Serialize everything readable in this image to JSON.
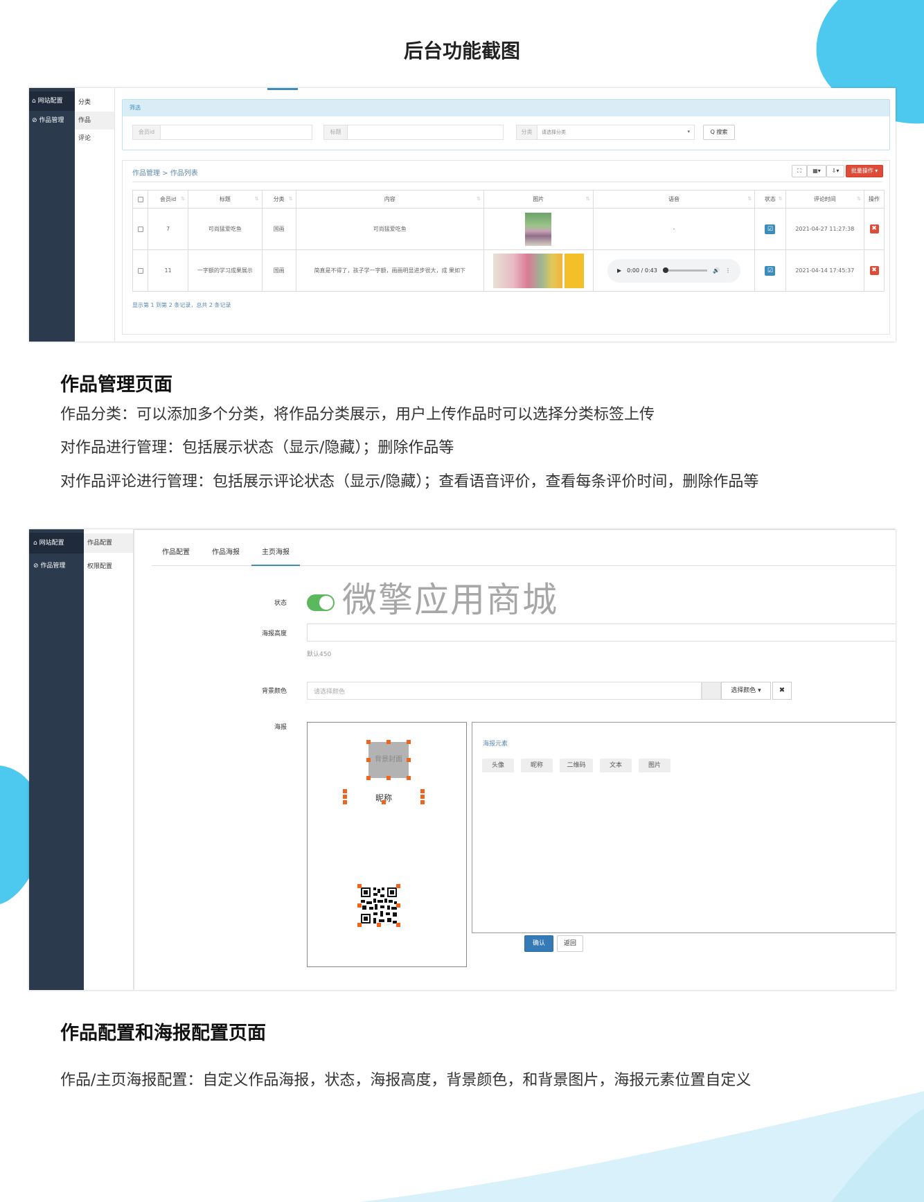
{
  "page_title": "后台功能截图",
  "colors": {
    "sidebar": "#2b3a4d",
    "accent": "#3c8dbc",
    "danger": "#dd4b39",
    "toggle": "#5cb85c",
    "deco_blue": "#4dc8ef"
  },
  "screen1": {
    "sidebar": [
      {
        "icon": "home-icon",
        "label": "网站配置"
      },
      {
        "icon": "slash-icon",
        "label": "作品管理"
      }
    ],
    "subnav": [
      "分类",
      "作品",
      "评论"
    ],
    "filter": {
      "title": "筛选",
      "member_label": "会员id",
      "title_label": "标题",
      "category_label": "分类",
      "category_placeholder": "请选择分类",
      "search_button": "Q 搜索"
    },
    "breadcrumb": "作品管理 > 作品列表",
    "toolbar": {
      "fullscreen_icon": "expand-icon",
      "columns_icon": "grid-icon",
      "export_icon": "export-icon",
      "batch_label": "批量操作"
    },
    "table": {
      "headers": [
        "会员id",
        "标题",
        "分类",
        "内容",
        "图片",
        "语音",
        "状态",
        "评论时间",
        "操作"
      ],
      "rows": [
        {
          "member_id": "7",
          "title": "可尚猛爱吃鱼",
          "category": "国画",
          "content": "可尚猛爱吃鱼",
          "voice": "-",
          "time": "2021-04-27 11:27:38"
        },
        {
          "member_id": "11",
          "title": "一字额的学习成果展示",
          "category": "国画",
          "content": "简直是不得了，孩子学一字额，画画明显进步很大，成 果如下",
          "voice": "0:00 / 0:43",
          "time": "2021-04-14 17:45:37"
        }
      ]
    },
    "footer": "显示第 1 到第 2 条记录，总共 2 条记录"
  },
  "section1": {
    "heading": "作品管理页面",
    "lines": [
      "作品分类：可以添加多个分类，将作品分类展示，用户上传作品时可以选择分类标签上传",
      "对作品进行管理：包括展示状态（显示/隐藏）；删除作品等",
      "对作品评论进行管理：包括展示评论状态（显示/隐藏）；查看语音评价，查看每条评价时间，删除作品等"
    ]
  },
  "screen2": {
    "sidebar": [
      {
        "icon": "home-icon",
        "label": "网站配置"
      },
      {
        "icon": "slash-icon",
        "label": "作品管理"
      }
    ],
    "subnav": [
      "作品配置",
      "权限配置"
    ],
    "tabs": [
      "作品配置",
      "作品海报",
      "主页海报"
    ],
    "active_tab": 2,
    "watermark": "微擎应用商城",
    "status_label": "状态",
    "status_on": true,
    "height_label": "海报高度",
    "height_hint": "默认450",
    "bg_label": "背景颜色",
    "bg_placeholder": "请选择颜色",
    "pick_color": "选择颜色 ▾",
    "clear_icon": "close-icon",
    "poster_label": "海报",
    "poster_cover": "背景封面",
    "poster_nickname": "昵称",
    "elements_title": "海报元素",
    "elements": [
      "头像",
      "昵称",
      "二维码",
      "文本",
      "图片"
    ],
    "confirm": "确认",
    "back": "返回"
  },
  "section2": {
    "heading": "作品配置和海报配置页面",
    "line": "作品/主页海报配置：自定义作品海报，状态，海报高度，背景颜色，和背景图片，海报元素位置自定义"
  }
}
